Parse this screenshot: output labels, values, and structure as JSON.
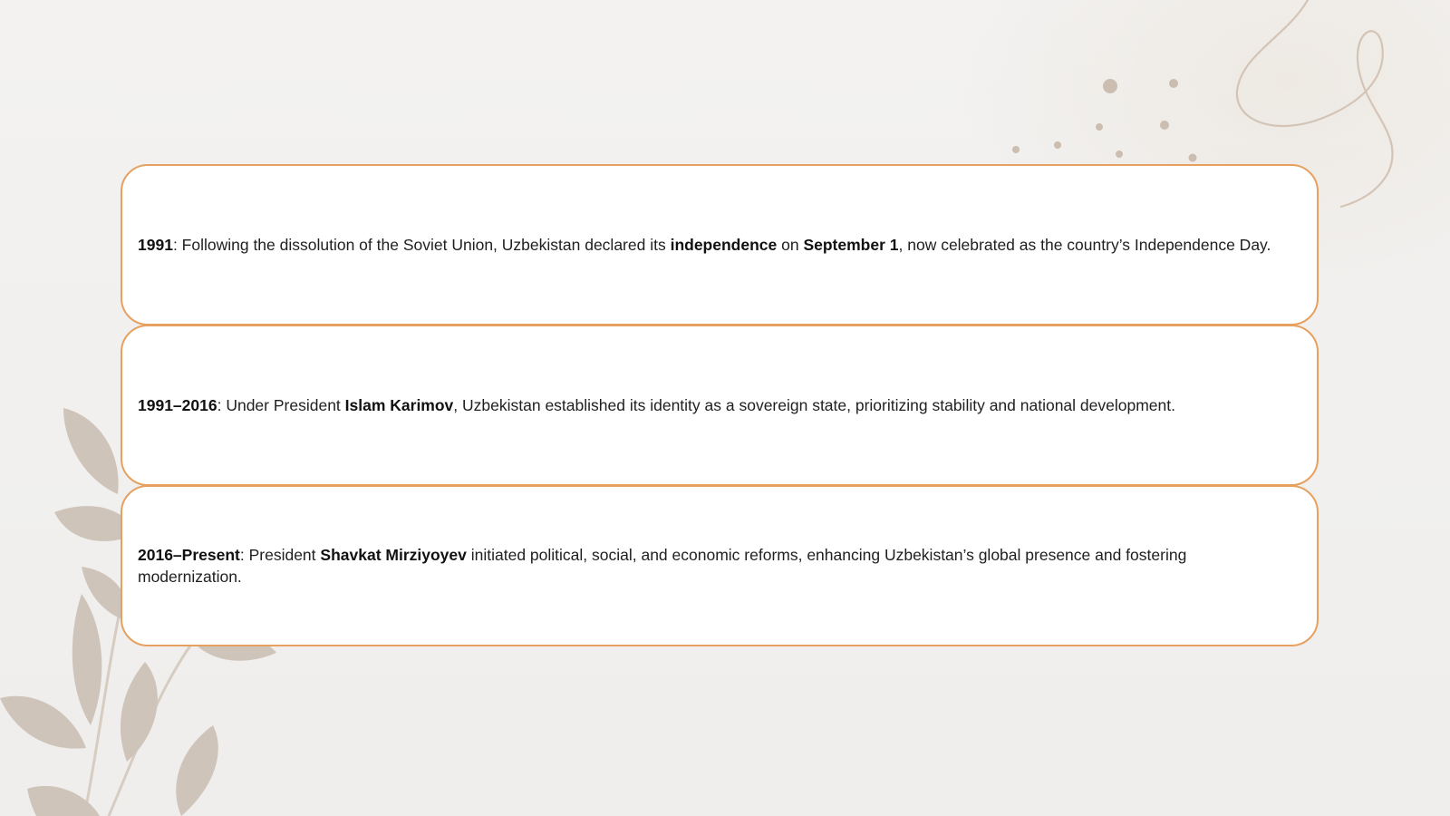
{
  "timeline": [
    {
      "segments": [
        {
          "text": "1991",
          "bold": true
        },
        {
          "text": ": Following the dissolution of the Soviet Union, Uzbekistan declared its ",
          "bold": false
        },
        {
          "text": "independence",
          "bold": true
        },
        {
          "text": " on ",
          "bold": false
        },
        {
          "text": "September 1",
          "bold": true
        },
        {
          "text": ", now celebrated as the country’s Independence Day.",
          "bold": false
        }
      ]
    },
    {
      "segments": [
        {
          "text": "1991–2016",
          "bold": true
        },
        {
          "text": ": Under President ",
          "bold": false
        },
        {
          "text": "Islam Karimov",
          "bold": true
        },
        {
          "text": ", Uzbekistan established its identity as a sovereign state, prioritizing stability and national development.",
          "bold": false
        }
      ]
    },
    {
      "segments": [
        {
          "text": "2016–Present",
          "bold": true
        },
        {
          "text": ": President ",
          "bold": false
        },
        {
          "text": "Shavkat Mirziyoyev",
          "bold": true
        },
        {
          "text": " initiated political, social, and economic reforms, enhancing Uzbekistan’s global presence and fostering modernization.",
          "bold": false
        }
      ]
    }
  ],
  "colors": {
    "card_border": "#e6a160",
    "leaf": "#c9bdb1",
    "swirl": "#d9cabd",
    "dots": "#cbbdb0",
    "background": "#f2f1f0"
  },
  "icons": [
    "leaf-branch-decoration",
    "swirl-decoration"
  ]
}
